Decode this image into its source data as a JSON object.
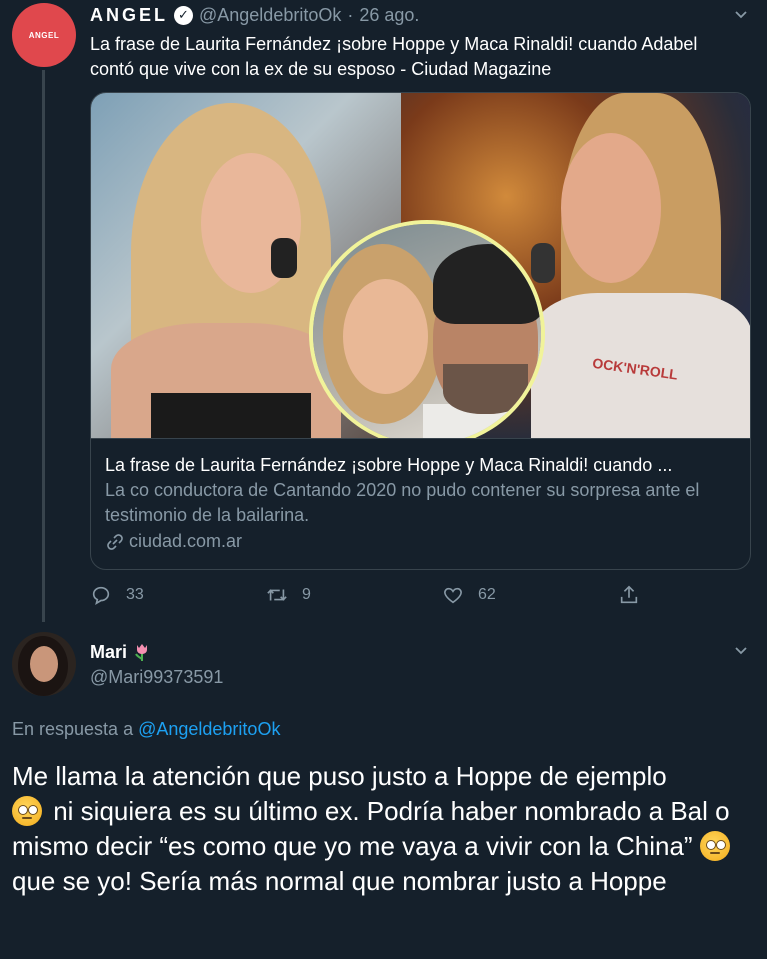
{
  "tweet": {
    "avatar_text": "ANGEL",
    "author_name": "ANGEL",
    "handle": "@AngeldebritoOk",
    "separator": "·",
    "date": "26 ago.",
    "text": "La frase de Laurita Fernández ¡sobre Hoppe y Maca Rinaldi! cuando Adabel contó que vive con la ex de su esposo - Ciudad Magazine",
    "card": {
      "image_shirt_text": "OCK'N'ROLL",
      "title": "La frase de Laurita Fernández ¡sobre Hoppe y Maca Rinaldi! cuando ...",
      "description": "La co conductora de Cantando 2020 no pudo contener su sorpresa ante el testimonio de la bailarina.",
      "domain": "ciudad.com.ar"
    },
    "actions": {
      "replies": "33",
      "retweets": "9",
      "likes": "62"
    }
  },
  "reply": {
    "author_name": "Mari",
    "handle": "@Mari99373591",
    "reply_prefix": "En respuesta a",
    "reply_mention": "@AngeldebritoOk",
    "text_part1": "Me llama la atención que puso justo a Hoppe de ejemplo",
    "text_part2": " ni siquiera es su último ex. Podría haber nombrado a Bal o mismo decir “es como que yo me vaya a vivir con la China”",
    "text_part3": "que se yo! Sería más normal que nombrar justo a Hoppe"
  },
  "colors": {
    "background": "#15202b",
    "secondary_text": "#8899a6",
    "link": "#1da1f2",
    "border": "#38444d",
    "avatar_red": "#e0484d"
  }
}
